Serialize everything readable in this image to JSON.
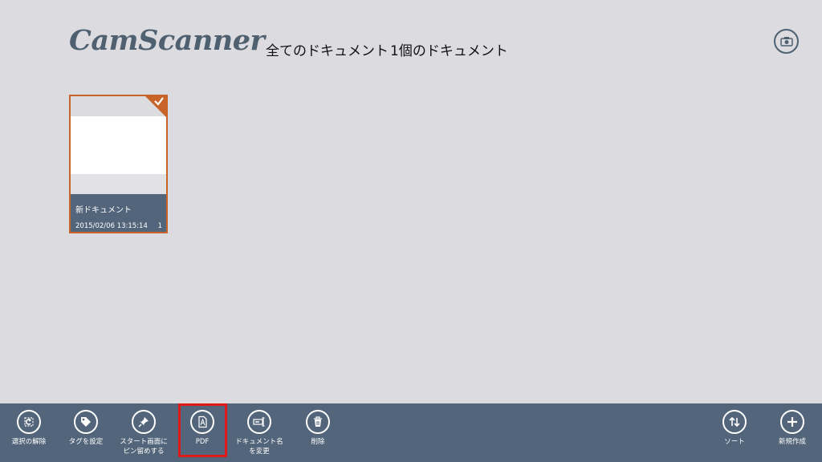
{
  "app": {
    "logo": "CamScanner"
  },
  "header": {
    "all_documents": "全てのドキュメント",
    "doc_count": "1個のドキュメント"
  },
  "top_right": {
    "icon": "camera-icon"
  },
  "documents": [
    {
      "name": "新ドキュメント",
      "datetime": "2015/02/06 13:15:14",
      "pages": "1",
      "selected": true
    }
  ],
  "appbar": {
    "left": [
      {
        "label": "選択の解除",
        "icon": "deselect-icon"
      },
      {
        "label": "タグを設定",
        "icon": "tag-icon"
      },
      {
        "label": "スタート画面に\nピン留めする",
        "icon": "pin-icon"
      },
      {
        "label": "PDF",
        "icon": "pdf-icon"
      },
      {
        "label": "ドキュメント名\nを変更",
        "icon": "rename-icon"
      },
      {
        "label": "削除",
        "icon": "trash-icon"
      }
    ],
    "right": [
      {
        "label": "ソート",
        "icon": "sort-icon"
      },
      {
        "label": "新規作成",
        "icon": "plus-icon"
      }
    ]
  },
  "colors": {
    "background": "#dcdce0",
    "appbar": "#53657a",
    "accent_selected": "#c8642a",
    "highlight": "#e01818"
  }
}
